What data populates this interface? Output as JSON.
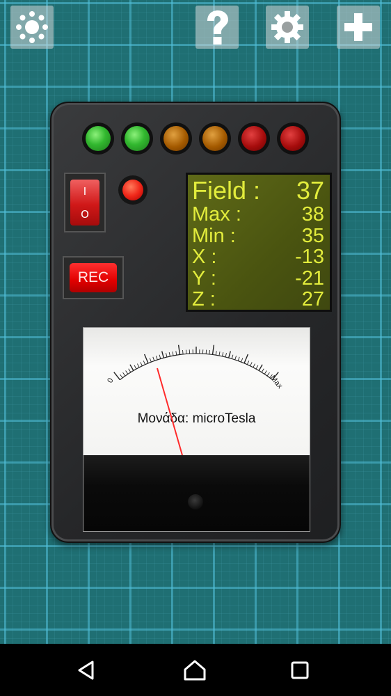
{
  "toolbar": {
    "brightness_icon": "sun-icon",
    "help_icon": "question-mark-icon",
    "settings_icon": "gear-icon",
    "add_icon": "plus-icon"
  },
  "device": {
    "leds": [
      {
        "color": "green",
        "hex": "#32b82f"
      },
      {
        "color": "green",
        "hex": "#32b82f"
      },
      {
        "color": "orange",
        "hex": "#a45a00"
      },
      {
        "color": "orange",
        "hex": "#a45a00"
      },
      {
        "color": "red",
        "hex": "#a60c0c"
      },
      {
        "color": "red",
        "hex": "#a60c0c"
      }
    ],
    "power_switch": {
      "on_label": "I",
      "off_label": "O"
    },
    "rec_label": "REC",
    "lcd": {
      "field_label": "Field :",
      "field_value": "37",
      "max_label": "Max :",
      "max_value": "38",
      "min_label": "Min :",
      "min_value": "35",
      "x_label": "X :",
      "x_value": "-13",
      "y_label": "Y :",
      "y_value": "-21",
      "z_label": "Z :",
      "z_value": "27",
      "text_color": "#e2ec3c"
    },
    "meter": {
      "min_label": "0",
      "max_label": "Max",
      "unit_text": "Μονάδα: microTesla",
      "needle_color": "#ff2a2a"
    }
  },
  "nav": {
    "back_icon": "back-triangle-icon",
    "home_icon": "home-icon",
    "recents_icon": "recents-square-icon"
  }
}
